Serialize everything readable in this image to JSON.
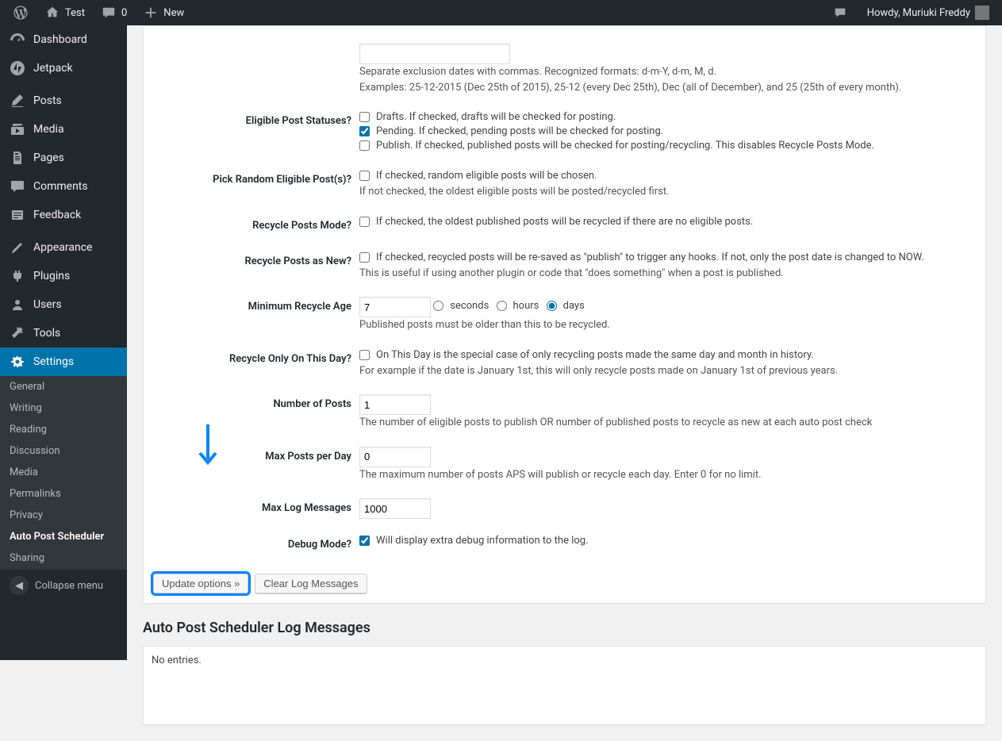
{
  "adminbar": {
    "site_title": "Test",
    "comments_count": "0",
    "new_label": "New",
    "howdy": "Howdy, Muriuki Freddy"
  },
  "sidebar": {
    "items": [
      {
        "icon": "dashboard",
        "label": "Dashboard"
      },
      {
        "icon": "jetpack",
        "label": "Jetpack"
      },
      {
        "sep": true
      },
      {
        "icon": "posts",
        "label": "Posts"
      },
      {
        "icon": "media",
        "label": "Media"
      },
      {
        "icon": "pages",
        "label": "Pages"
      },
      {
        "icon": "comments",
        "label": "Comments"
      },
      {
        "icon": "feedback",
        "label": "Feedback"
      },
      {
        "sep": true
      },
      {
        "icon": "appearance",
        "label": "Appearance"
      },
      {
        "icon": "plugins",
        "label": "Plugins"
      },
      {
        "icon": "users",
        "label": "Users"
      },
      {
        "icon": "tools",
        "label": "Tools"
      },
      {
        "icon": "settings",
        "label": "Settings",
        "current": true
      }
    ],
    "submenu": [
      {
        "label": "General"
      },
      {
        "label": "Writing"
      },
      {
        "label": "Reading"
      },
      {
        "label": "Discussion"
      },
      {
        "label": "Media"
      },
      {
        "label": "Permalinks"
      },
      {
        "label": "Privacy"
      },
      {
        "label": "Auto Post Scheduler",
        "active": true
      },
      {
        "label": "Sharing"
      }
    ],
    "collapse": "Collapse menu"
  },
  "form": {
    "exclusion_desc1": "Separate exclusion dates with commas. Recognized formats: d-m-Y, d-m, M, d.",
    "exclusion_desc2": "Examples: 25-12-2015 (Dec 25th of 2015), 25-12 (every Dec 25th), Dec (all of December), and 25 (25th of every month).",
    "statuses_label": "Eligible Post Statuses?",
    "statuses_drafts": "Drafts. If checked, drafts will be checked for posting.",
    "statuses_pending": "Pending. If checked, pending posts will be checked for posting.",
    "statuses_publish": "Publish. If checked, published posts will be checked for posting/recycling. This disables Recycle Posts Mode.",
    "random_label": "Pick Random Eligible Post(s)?",
    "random_check": "If checked, random eligible posts will be chosen.",
    "random_desc": "If not checked, the oldest eligible posts will be posted/recycled first.",
    "recycle_mode_label": "Recycle Posts Mode?",
    "recycle_mode_check": "If checked, the oldest published posts will be recycled if there are no eligible posts.",
    "recycle_new_label": "Recycle Posts as New?",
    "recycle_new_check": "If checked, recycled posts will be re-saved as \"publish\" to trigger any hooks. If not, only the post date is changed to NOW.",
    "recycle_new_desc": "This is useful if using another plugin or code that \"does something\" when a post is published.",
    "min_age_label": "Minimum Recycle Age",
    "min_age_value": "7",
    "seconds": "seconds",
    "hours": "hours",
    "days": "days",
    "min_age_desc": "Published posts must be older than this to be recycled.",
    "on_this_day_label": "Recycle Only On This Day?",
    "on_this_day_check": "On This Day is the special case of only recycling posts made the same day and month in history.",
    "on_this_day_desc": "For example if the date is January 1st, this will only recycle posts made on January 1st of previous years.",
    "num_posts_label": "Number of Posts",
    "num_posts_value": "1",
    "num_posts_desc": "The number of eligible posts to publish OR number of published posts to recycle as new at each auto post check",
    "max_day_label": "Max Posts per Day",
    "max_day_value": "0",
    "max_day_desc": "The maximum number of posts APS will publish or recycle each day. Enter 0 for no limit.",
    "max_log_label": "Max Log Messages",
    "max_log_value": "1000",
    "debug_label": "Debug Mode?",
    "debug_check": "Will display extra debug information to the log.",
    "btn_update": "Update options »",
    "btn_clear": "Clear Log Messages"
  },
  "log": {
    "title": "Auto Post Scheduler Log Messages",
    "empty": "No entries."
  }
}
